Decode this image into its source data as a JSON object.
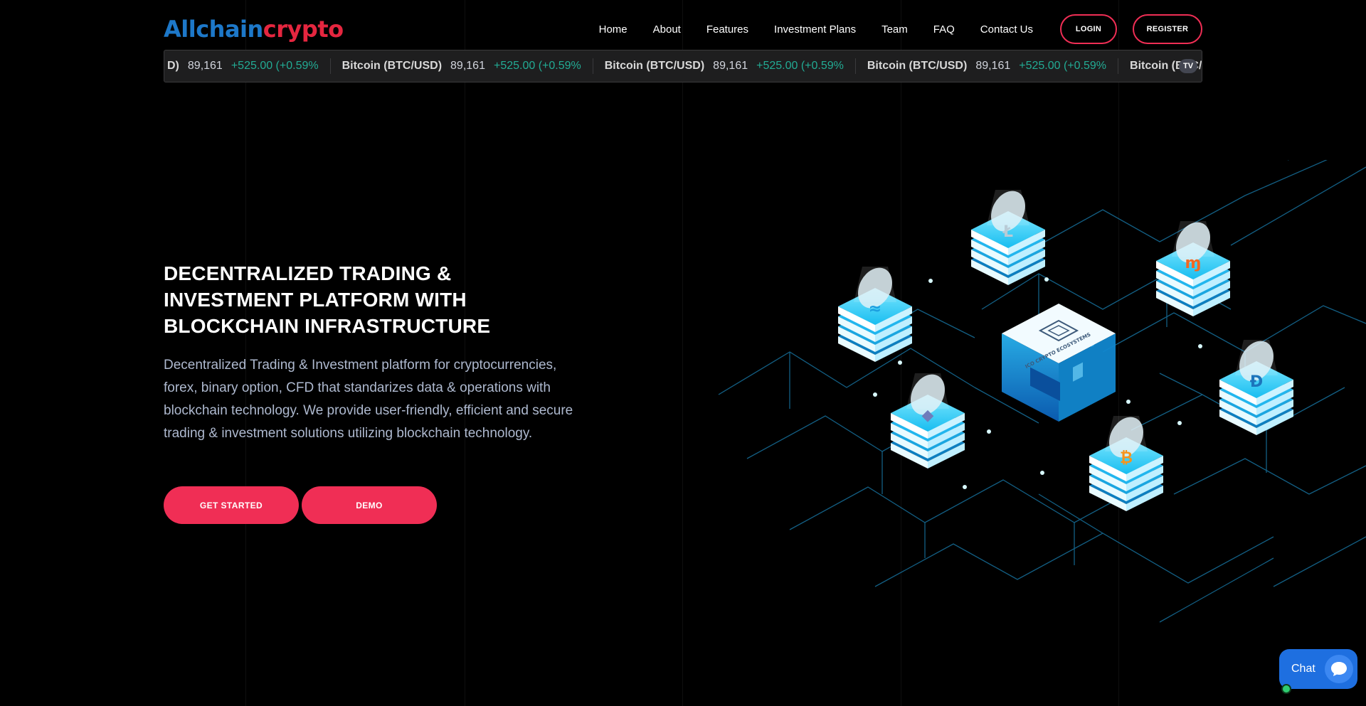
{
  "brand": {
    "part1": "Allchain",
    "part2": "crypto",
    "color1": "#1d78c9",
    "color2": "#e5263f"
  },
  "nav": {
    "items": [
      "Home",
      "About",
      "Features",
      "Investment Plans",
      "Team",
      "FAQ",
      "Contact Us"
    ],
    "login_label": "LOGIN",
    "register_label": "REGISTER"
  },
  "ticker": {
    "leading_fragment": {
      "name": "D)",
      "price": "89,161",
      "change": "+525.00 (+0.59%"
    },
    "items": [
      {
        "name": "Bitcoin (BTC/USD)",
        "price": "89,161",
        "change": "+525.00 (+0.59%"
      },
      {
        "name": "Bitcoin (BTC/USD)",
        "price": "89,161",
        "change": "+525.00 (+0.59%"
      },
      {
        "name": "Bitcoin (BTC/USD)",
        "price": "89,161",
        "change": "+525.00 (+0.59%"
      },
      {
        "name": "Bitcoin (BTC/USD)",
        "price": "",
        "change": ""
      }
    ],
    "badge": "TV"
  },
  "hero": {
    "title": "DECENTRALIZED TRADING & INVESTMENT PLATFORM WITH BLOCKCHAIN INFRASTRUCTURE",
    "text": "Decentralized Trading & Investment platform for cryptocurrencies, forex, binary option, CFD that standarizes data & operations with blockchain technology. We provide user-friendly, efficient and secure trading & investment solutions utilizing blockchain technology.",
    "get_started_label": "GET STARTED",
    "demo_label": "DEMO"
  },
  "illustration": {
    "center_label": "ICO CRYPTO ECOSYSTEMS"
  },
  "chat": {
    "label": "Chat"
  },
  "colors": {
    "accent": "#f02e55",
    "positive": "#22ab94",
    "cyan": "#1fc6f2"
  }
}
